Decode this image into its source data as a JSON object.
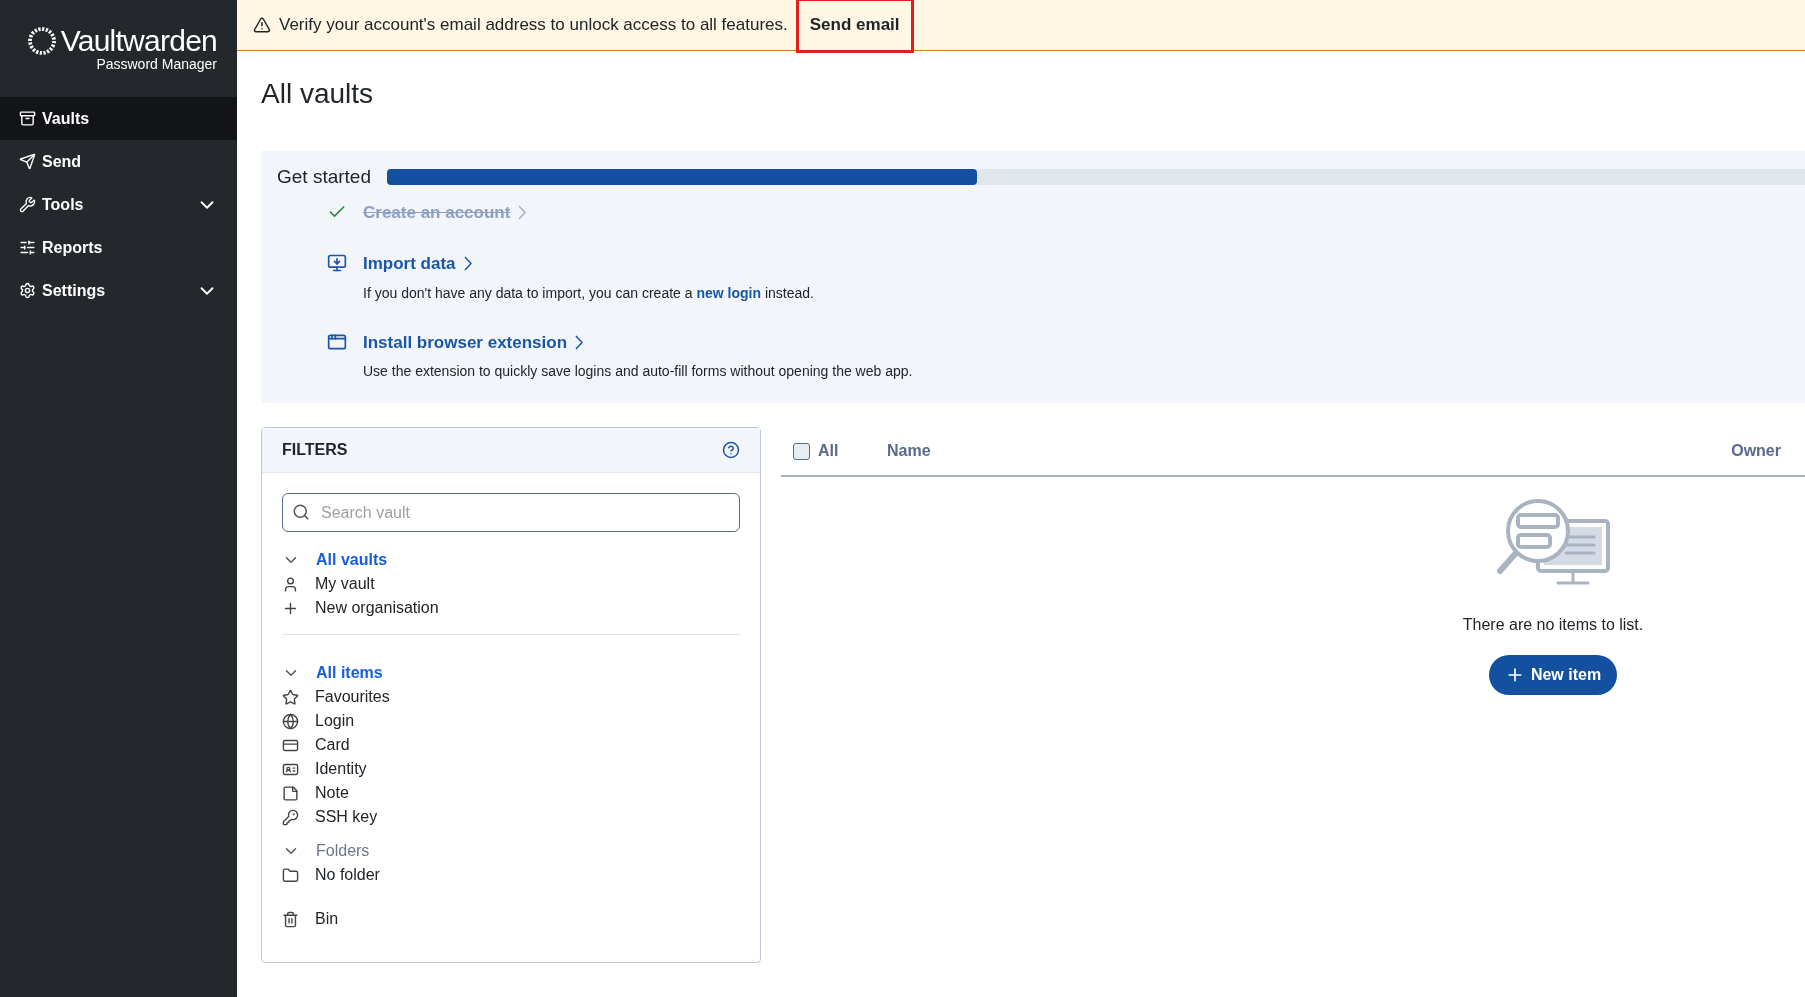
{
  "sidebar": {
    "logo": {
      "title": "Vaultwarden",
      "subtitle": "Password Manager"
    },
    "items": [
      {
        "label": "Vaults",
        "kind": "vault",
        "selected": true
      },
      {
        "label": "Send",
        "kind": "send",
        "selected": false
      },
      {
        "label": "Tools",
        "kind": "tools",
        "selected": false,
        "expanded": false
      },
      {
        "label": "Reports",
        "kind": "reports",
        "selected": false
      },
      {
        "label": "Settings",
        "kind": "settings",
        "selected": false,
        "expanded": false
      }
    ]
  },
  "banner": {
    "message": "Verify your account's email address to unlock access to all features.",
    "button": {
      "label": "Send email",
      "highlighted": true
    }
  },
  "page_title": "All vaults",
  "get_started": {
    "title": "Get started",
    "level": 0.416,
    "steps": [
      {
        "kind": "account",
        "title": "Create an account",
        "done": true
      },
      {
        "kind": "import",
        "title": "Import data",
        "done": false,
        "description": "If you don't have any data to import, you can create a ",
        "link": "new login",
        "description_end": " instead."
      },
      {
        "kind": "extension",
        "title": "Install browser extension",
        "done": false,
        "description": "Use the extension to quickly save logins and auto-fill forms without opening the web app."
      }
    ]
  },
  "filters": {
    "title": "FILTERS",
    "search": {
      "placeholder": "Search vault"
    },
    "groups": [
      {
        "header": {
          "label": "All vaults",
          "selected": true,
          "expanded": true
        },
        "items": [
          {
            "label": "My vault",
            "kind": "user"
          },
          {
            "label": "New organisation",
            "kind": "add"
          }
        ]
      },
      {
        "divider": true,
        "header": {
          "label": "All items",
          "selected": true,
          "expanded": true
        },
        "items": [
          {
            "label": "Favourites",
            "kind": "star"
          },
          {
            "label": "Login",
            "kind": "globe"
          },
          {
            "label": "Card",
            "kind": "card"
          },
          {
            "label": "Identity",
            "kind": "identity"
          },
          {
            "label": "Note",
            "kind": "note"
          },
          {
            "label": "SSH key",
            "kind": "key"
          }
        ]
      },
      {
        "header": {
          "label": "Folders",
          "selected": false,
          "expanded": true
        },
        "items": [
          {
            "label": "No folder",
            "kind": "folder"
          }
        ]
      },
      {
        "items": [
          {
            "label": "Bin",
            "kind": "bin"
          }
        ]
      }
    ]
  },
  "table": {
    "select_all": {
      "label": "All",
      "checked": false
    },
    "columns": [
      "Name",
      "Owner"
    ],
    "empty": {
      "message": "There are no items to list.",
      "button": "New item"
    }
  }
}
